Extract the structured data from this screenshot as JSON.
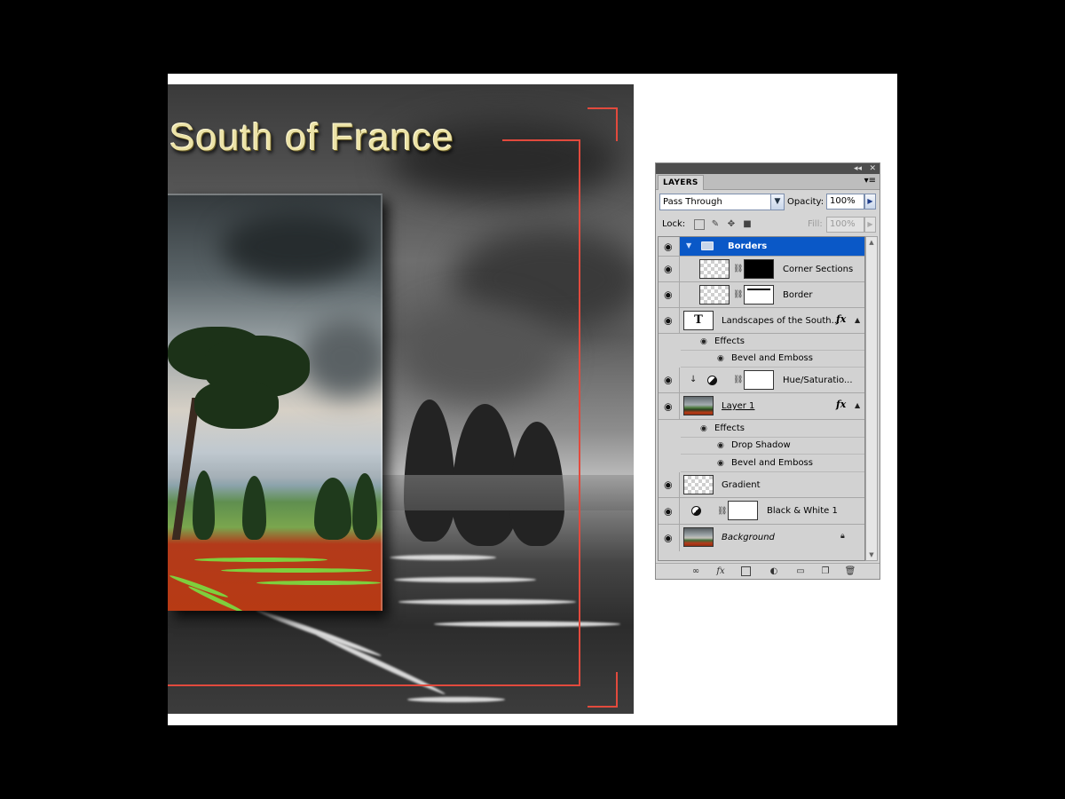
{
  "artwork": {
    "title": "South of France",
    "accent_color": "#e24a3d",
    "title_color": "#ece3a7"
  },
  "panel": {
    "tab_label": "LAYERS",
    "collapse_glyph": "◂◂",
    "close_glyph": "✕",
    "menu_glyph": "▾≡",
    "blend_mode": "Pass Through",
    "opacity_label": "Opacity:",
    "opacity_value": "100%",
    "lock_label": "Lock:",
    "fill_label": "Fill:",
    "fill_value": "100%",
    "layers": [
      {
        "name": "Borders",
        "type": "group",
        "selected": true
      },
      {
        "name": "Corner Sections",
        "type": "pixel-with-mask"
      },
      {
        "name": "Border",
        "type": "pixel-with-mask"
      },
      {
        "name": "Landscapes of the South...",
        "type": "text",
        "effects_label": "Effects",
        "effects": [
          "Bevel and Emboss"
        ]
      },
      {
        "name": "Hue/Saturatio...",
        "type": "adjustment"
      },
      {
        "name": "Layer 1",
        "type": "pixel",
        "effects_label": "Effects",
        "effects": [
          "Drop Shadow",
          "Bevel and Emboss"
        ]
      },
      {
        "name": "Gradient",
        "type": "pixel"
      },
      {
        "name": "Black & White 1",
        "type": "adjustment"
      },
      {
        "name": "Background",
        "type": "background",
        "locked": true
      }
    ],
    "text_layer_glyph": "T",
    "fx_glyph": "fx",
    "bottom_icons": [
      "link-layers-icon",
      "add-style-icon",
      "add-mask-icon",
      "new-adjustment-icon",
      "new-group-icon",
      "new-layer-icon",
      "delete-icon"
    ]
  }
}
